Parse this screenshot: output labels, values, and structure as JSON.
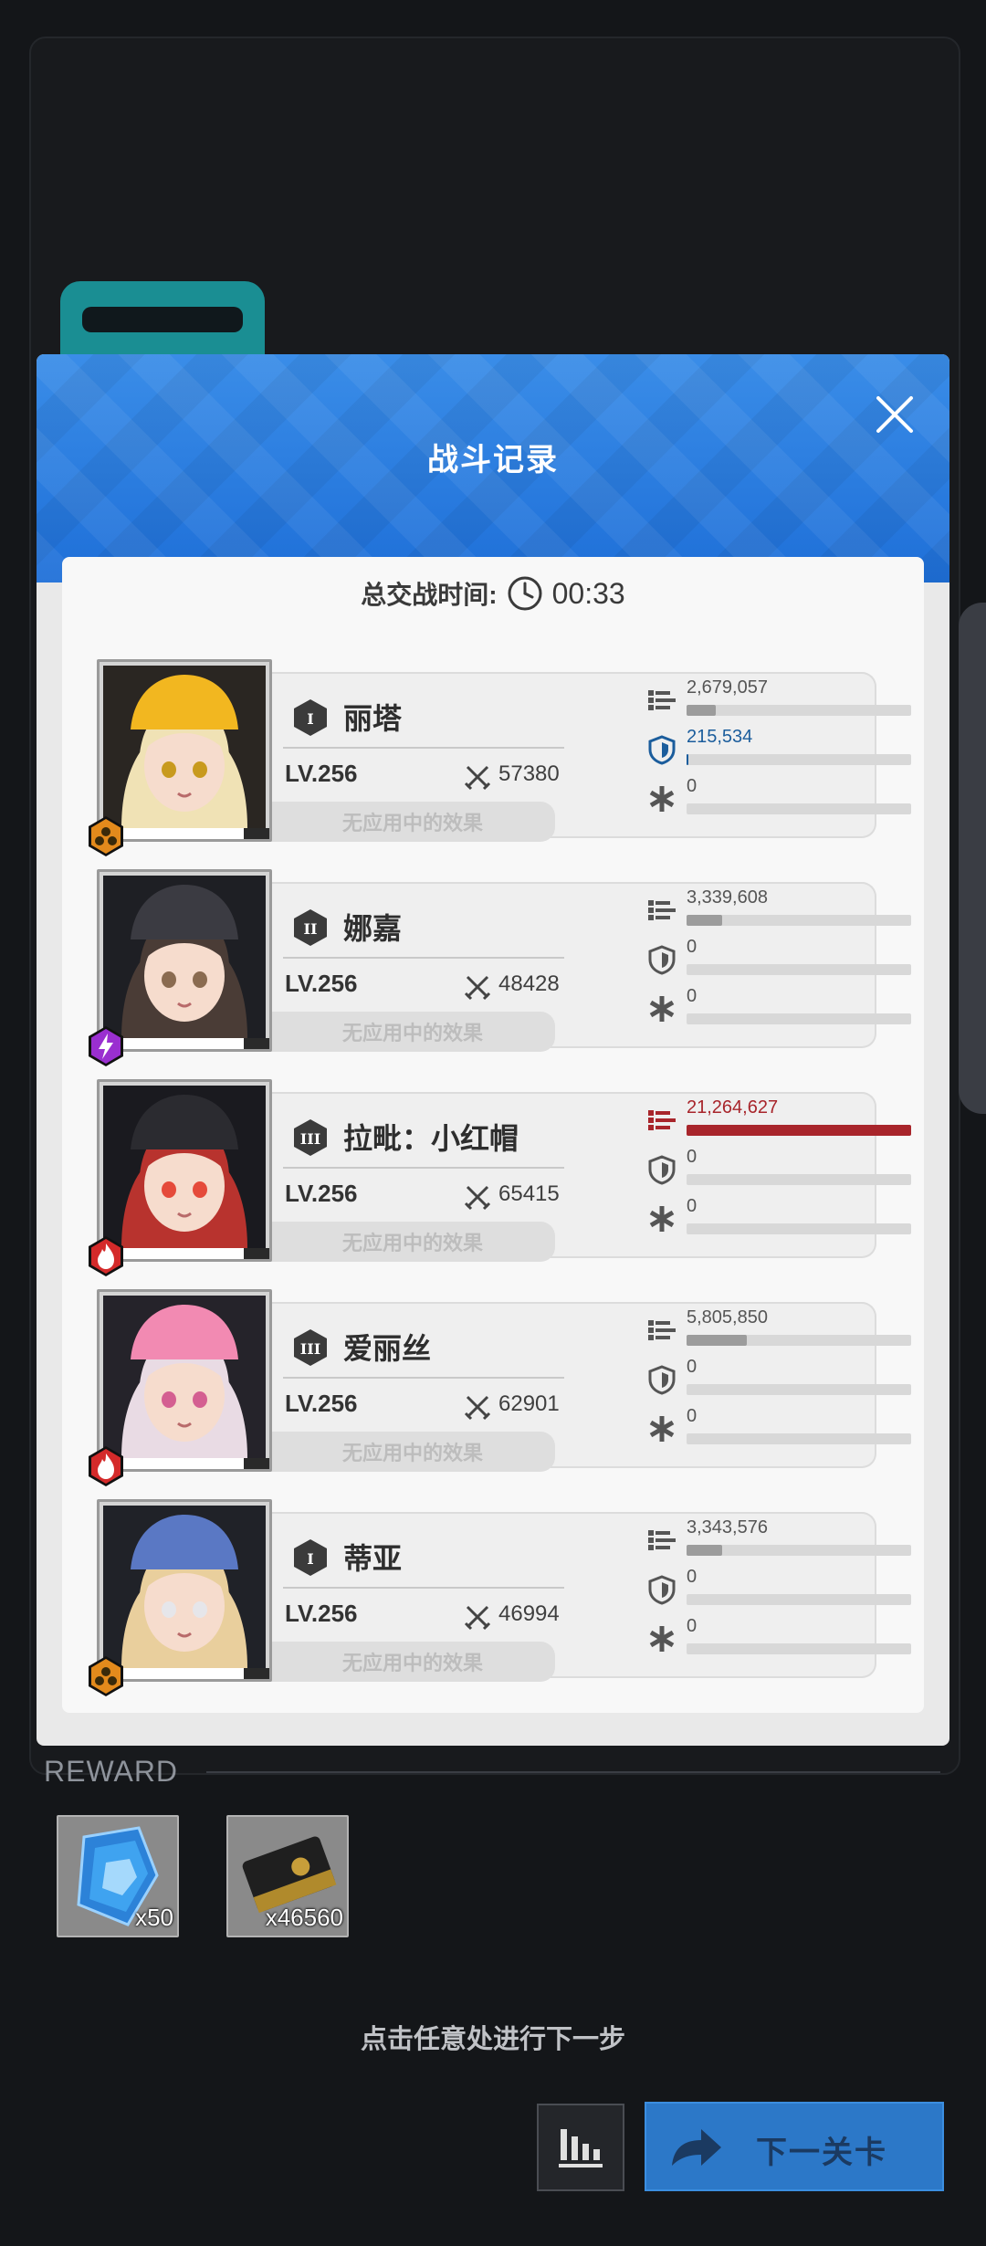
{
  "modal": {
    "title": "战斗记录",
    "total_time_label": "总交战时间:",
    "total_time": "00:33"
  },
  "characters": [
    {
      "name": "丽塔",
      "burst": "I",
      "element": "iron",
      "level": "LV.256",
      "power": "57380",
      "effect": "无应用中的效果",
      "damage": "2,679,057",
      "damage_pct": 0.13,
      "shield": "215,534",
      "shield_pct": 0.01,
      "heal": "0",
      "heal_pct": 0,
      "damage_highlight": false
    },
    {
      "name": "娜嘉",
      "burst": "II",
      "element": "electric",
      "level": "LV.256",
      "power": "48428",
      "effect": "无应用中的效果",
      "damage": "3,339,608",
      "damage_pct": 0.16,
      "shield": "0",
      "shield_pct": 0,
      "heal": "0",
      "heal_pct": 0,
      "damage_highlight": false
    },
    {
      "name": "拉毗：小红帽",
      "burst": "III",
      "element": "fire",
      "level": "LV.256",
      "power": "65415",
      "effect": "无应用中的效果",
      "damage": "21,264,627",
      "damage_pct": 1.0,
      "shield": "0",
      "shield_pct": 0,
      "heal": "0",
      "heal_pct": 0,
      "damage_highlight": true
    },
    {
      "name": "爱丽丝",
      "burst": "III",
      "element": "fire",
      "level": "LV.256",
      "power": "62901",
      "effect": "无应用中的效果",
      "damage": "5,805,850",
      "damage_pct": 0.27,
      "shield": "0",
      "shield_pct": 0,
      "heal": "0",
      "heal_pct": 0,
      "damage_highlight": false
    },
    {
      "name": "蒂亚",
      "burst": "I",
      "element": "iron",
      "level": "LV.256",
      "power": "46994",
      "effect": "无应用中的效果",
      "damage": "3,343,576",
      "damage_pct": 0.16,
      "shield": "0",
      "shield_pct": 0,
      "heal": "0",
      "heal_pct": 0,
      "damage_highlight": false
    }
  ],
  "reward": {
    "label": "REWARD",
    "items": [
      {
        "icon": "blue-crystal-icon",
        "count": "x50"
      },
      {
        "icon": "credit-case-icon",
        "count": "x46560"
      }
    ]
  },
  "hint": "点击任意处进行下一步",
  "buttons": {
    "stats_icon": "bar-chart-icon",
    "next_label": "下一关卡"
  },
  "colors": {
    "header_blue": "#2a7ee0",
    "damage_red": "#a8252b",
    "shield_blue": "#1b5d9c",
    "iron": "#e38a1c",
    "electric": "#9a2fd0",
    "fire": "#d42a2a"
  }
}
